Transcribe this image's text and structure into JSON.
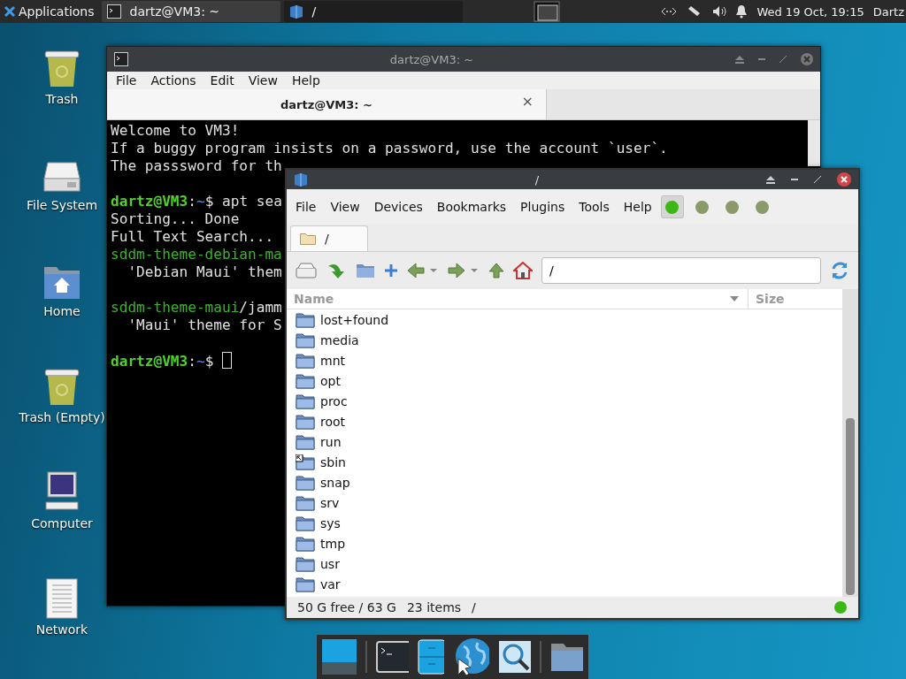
{
  "top_panel": {
    "apps_menu": "Applications",
    "tasks": [
      {
        "label": "dartz@VM3: ~",
        "kind": "terminal",
        "selected": true
      },
      {
        "label": "/",
        "kind": "files",
        "selected": false
      }
    ],
    "clock": "Wed 19 Oct, 19:15",
    "user": "Dartz"
  },
  "desktop_icons": [
    {
      "label": "Trash",
      "kind": "trash"
    },
    {
      "label": "File System",
      "kind": "drive"
    },
    {
      "label": "Home",
      "kind": "home"
    },
    {
      "label": "Trash (Empty)",
      "kind": "trash"
    },
    {
      "label": "Computer",
      "kind": "computer"
    },
    {
      "label": "Network",
      "kind": "document"
    }
  ],
  "terminal": {
    "title": "dartz@VM3: ~",
    "menu": [
      "File",
      "Actions",
      "Edit",
      "View",
      "Help"
    ],
    "tab": "dartz@VM3: ~",
    "tab_close": "×",
    "lines": [
      [
        {
          "text": "Welcome to VM3!",
          "kind": "text"
        }
      ],
      [
        {
          "text": "If a buggy program insists on a password, use the account `user`.",
          "kind": "text"
        }
      ],
      [
        {
          "text": "The passsword for th",
          "kind": "text"
        }
      ],
      [
        {
          "kind": "blank"
        }
      ],
      [
        {
          "text": "dartz@VM3",
          "kind": "user"
        },
        {
          "text": ":",
          "kind": "text"
        },
        {
          "text": "~",
          "kind": "path"
        },
        {
          "text": "$ apt sea",
          "kind": "text"
        }
      ],
      [
        {
          "text": "Sorting... Done",
          "kind": "text"
        }
      ],
      [
        {
          "text": "Full Text Search...",
          "kind": "text"
        }
      ],
      [
        {
          "text": "sddm-theme-debian-ma",
          "kind": "pkg"
        }
      ],
      [
        {
          "text": "  'Debian Maui' them",
          "kind": "text"
        }
      ],
      [
        {
          "kind": "blank"
        }
      ],
      [
        {
          "text": "sddm-theme-maui",
          "kind": "pkg"
        },
        {
          "text": "/jamm",
          "kind": "text"
        }
      ],
      [
        {
          "text": "  'Maui' theme for S",
          "kind": "text"
        }
      ],
      [
        {
          "kind": "blank"
        }
      ],
      [
        {
          "text": "dartz@VM3",
          "kind": "user"
        },
        {
          "text": ":",
          "kind": "text"
        },
        {
          "text": "~",
          "kind": "path"
        },
        {
          "text": "$ ",
          "kind": "text"
        },
        {
          "kind": "cursor"
        }
      ]
    ]
  },
  "file_manager": {
    "title": "/",
    "menu": [
      "File",
      "View",
      "Devices",
      "Bookmarks",
      "Plugins",
      "Tools",
      "Help"
    ],
    "panel_toggles": [
      {
        "selected": true
      },
      {
        "selected": false
      },
      {
        "selected": false
      },
      {
        "selected": false
      }
    ],
    "tab": "/",
    "path": "/",
    "columns": [
      "Name",
      "Size"
    ],
    "items": [
      {
        "name": "lost+found",
        "kind": "folder"
      },
      {
        "name": "media",
        "kind": "folder"
      },
      {
        "name": "mnt",
        "kind": "folder"
      },
      {
        "name": "opt",
        "kind": "folder"
      },
      {
        "name": "proc",
        "kind": "folder"
      },
      {
        "name": "root",
        "kind": "folder"
      },
      {
        "name": "run",
        "kind": "folder"
      },
      {
        "name": "sbin",
        "kind": "link"
      },
      {
        "name": "snap",
        "kind": "folder"
      },
      {
        "name": "srv",
        "kind": "folder"
      },
      {
        "name": "sys",
        "kind": "folder"
      },
      {
        "name": "tmp",
        "kind": "folder"
      },
      {
        "name": "usr",
        "kind": "folder"
      },
      {
        "name": "var",
        "kind": "folder"
      }
    ],
    "status": {
      "free": "50 G free / 63 G",
      "count": "23 items",
      "path": "/"
    }
  }
}
